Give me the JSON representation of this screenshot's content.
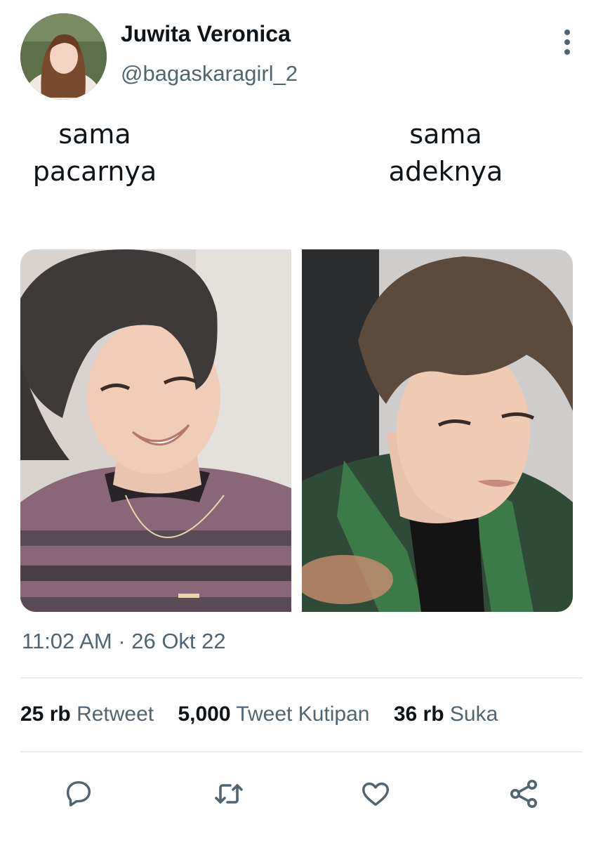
{
  "user": {
    "display_name": "Juwita Veronica",
    "handle": "@bagaskaragirl_2"
  },
  "tweet": {
    "caption_left": "sama\npacarnya",
    "caption_right": "sama\nadeknya",
    "timestamp": "11:02 AM · 26 Okt 22"
  },
  "stats": {
    "retweets_count": "25 rb",
    "retweets_label": "Retweet",
    "quotes_count": "5,000",
    "quotes_label": "Tweet Kutipan",
    "likes_count": "36 rb",
    "likes_label": "Suka"
  },
  "icons": {
    "more": "more-vertical-icon",
    "reply": "reply-icon",
    "retweet": "retweet-icon",
    "like": "heart-icon",
    "share": "share-icon"
  },
  "colors": {
    "text_primary": "#0f1419",
    "text_secondary": "#536471",
    "divider": "#e6ecf0"
  }
}
